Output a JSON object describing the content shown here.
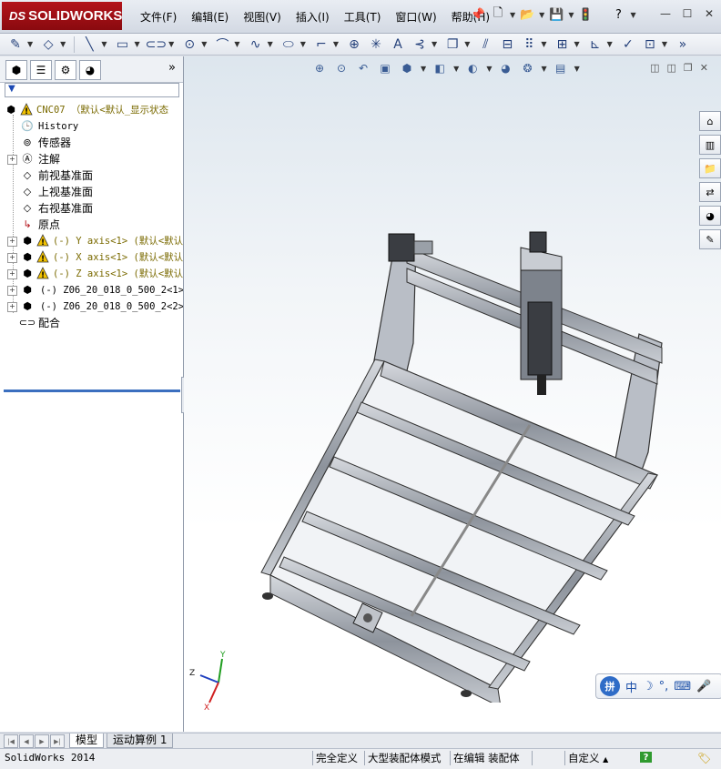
{
  "app": {
    "brand": "SOLIDWORKS",
    "brand_prefix": "DS"
  },
  "menu": [
    "文件(F)",
    "编辑(E)",
    "视图(V)",
    "插入(I)",
    "工具(T)",
    "窗口(W)",
    "帮助(H)"
  ],
  "feature_manager": {
    "filter_label": "▼",
    "root": "CNC07 （默认<默认_显示状态",
    "items": [
      {
        "label": "History",
        "mono": true
      },
      {
        "label": "传感器"
      },
      {
        "label": "注解",
        "expandable": true
      },
      {
        "label": "前视基准面"
      },
      {
        "label": "上视基准面"
      },
      {
        "label": "右视基准面"
      },
      {
        "label": "原点"
      },
      {
        "label": "(-) Y axis<1> (默认<默认",
        "expandable": true,
        "warning": true,
        "mono": true
      },
      {
        "label": "(-) X axis<1> (默认<默认",
        "expandable": true,
        "warning": true,
        "mono": true
      },
      {
        "label": "(-) Z axis<1> (默认<默认",
        "expandable": true,
        "warning": true,
        "mono": true
      },
      {
        "label": "(-) Z06_20_018_0_500_2<1>",
        "expandable": true,
        "mono": true
      },
      {
        "label": "(-) Z06_20_018_0_500_2<2>",
        "expandable": true,
        "mono": true
      },
      {
        "label": "配合"
      }
    ]
  },
  "bottom_tabs": [
    "模型",
    "运动算例 1"
  ],
  "status": {
    "app_version": "SolidWorks 2014",
    "constraint": "完全定义",
    "mode": "大型装配体模式",
    "editing": "在编辑 装配体",
    "units": "自定义",
    "units_arrow": "▲"
  },
  "ime": {
    "badge": "拼",
    "mode": "中"
  },
  "triad": {
    "x": "X",
    "y": "Y",
    "z": "Z"
  },
  "colors": {
    "brand_red": "#b3141b",
    "tree_divider": "#3b6fbf",
    "warning": "#f2c200"
  }
}
